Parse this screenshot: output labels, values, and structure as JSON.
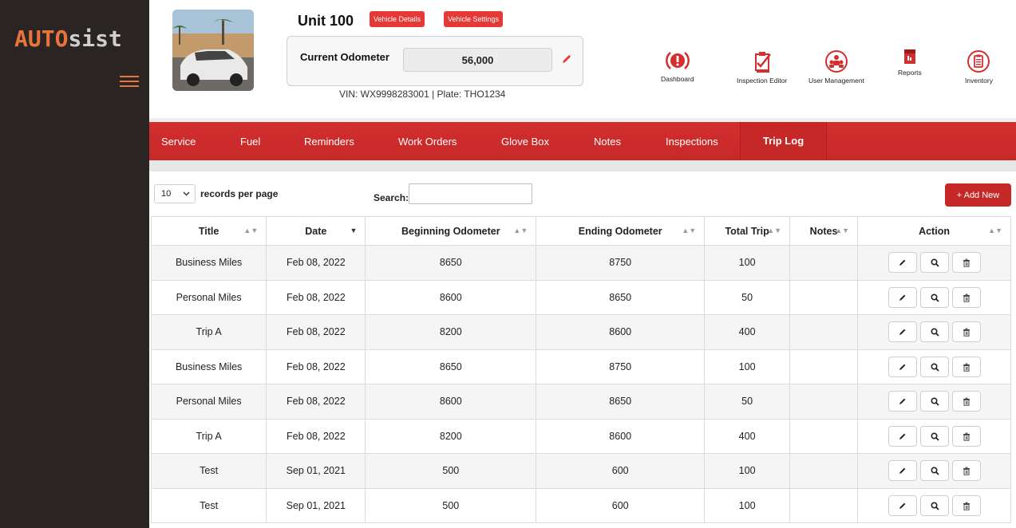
{
  "brand": {
    "logo_part1": "AUTO",
    "logo_part2": "sist",
    "accent": "#e8743b"
  },
  "header": {
    "unit_title": "Unit 100",
    "vehicle_details_label": "Vehicle Details",
    "vehicle_settings_label": "Vehicle Settings",
    "odometer_label": "Current Odometer",
    "odometer_value": "56,000",
    "vin_plate": "VIN: WX9998283001 | Plate: THO1234",
    "icons": [
      {
        "label": "Dashboard",
        "icon": "alert-circle-icon"
      },
      {
        "label": "Inspection Editor",
        "icon": "checklist-icon"
      },
      {
        "label": "User Management",
        "icon": "users-icon"
      },
      {
        "label": "Reports",
        "icon": "report-icon"
      },
      {
        "label": "Inventory",
        "icon": "clipboard-icon"
      }
    ]
  },
  "tabs": [
    "Service",
    "Fuel",
    "Reminders",
    "Work Orders",
    "Glove Box",
    "Notes",
    "Inspections",
    "Trip Log"
  ],
  "active_tab": "Trip Log",
  "controls": {
    "per_page_value": "10",
    "per_page_label": "records per page",
    "search_label": "Search:",
    "search_value": "",
    "add_new_label": "+ Add New"
  },
  "table": {
    "columns": [
      "Title",
      "Date",
      "Beginning Odometer",
      "Ending Odometer",
      "Total Trip",
      "Notes",
      "Action"
    ],
    "rows": [
      [
        "Business Miles",
        "Feb 08, 2022",
        "8650",
        "8750",
        "100",
        ""
      ],
      [
        "Personal Miles",
        "Feb 08, 2022",
        "8600",
        "8650",
        "50",
        ""
      ],
      [
        "Trip A",
        "Feb 08, 2022",
        "8200",
        "8600",
        "400",
        ""
      ],
      [
        "Business Miles",
        "Feb 08, 2022",
        "8650",
        "8750",
        "100",
        ""
      ],
      [
        "Personal Miles",
        "Feb 08, 2022",
        "8600",
        "8650",
        "50",
        ""
      ],
      [
        "Trip A",
        "Feb 08, 2022",
        "8200",
        "8600",
        "400",
        ""
      ],
      [
        "Test",
        "Sep 01, 2021",
        "500",
        "600",
        "100",
        ""
      ],
      [
        "Test",
        "Sep 01, 2021",
        "500",
        "600",
        "100",
        ""
      ]
    ]
  }
}
